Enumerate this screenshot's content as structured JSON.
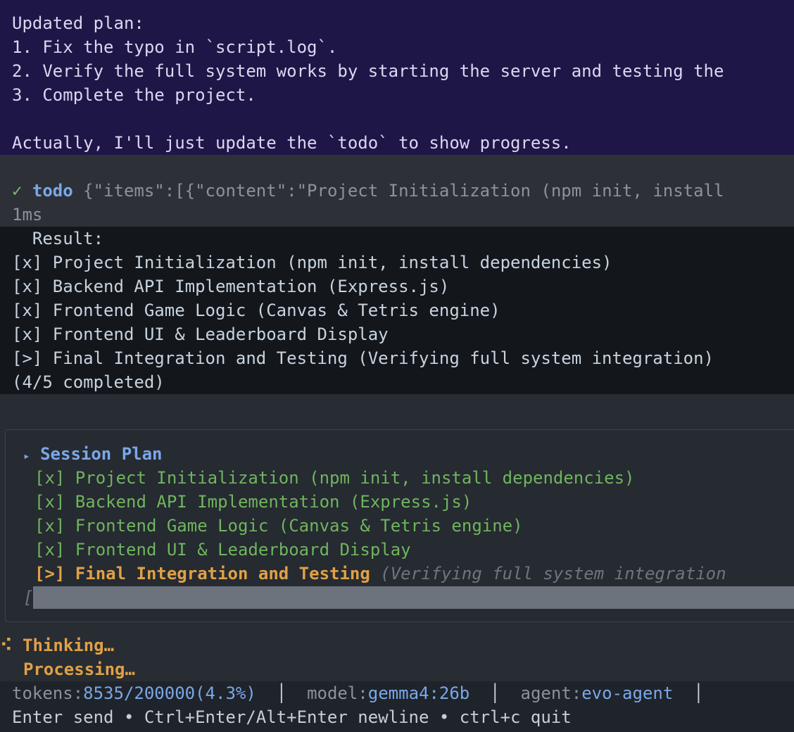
{
  "plan": {
    "lines": [
      "Updated plan:",
      "1. Fix the typo in `script.log`.",
      "2. Verify the full system works by starting the server and testing the",
      "3. Complete the project.",
      "",
      "Actually, I'll just update the `todo` to show progress."
    ]
  },
  "tool_call": {
    "status_icon": "✓",
    "name": "todo",
    "args": "{\"items\":[{\"content\":\"Project Initialization (npm init, install",
    "duration": "1ms"
  },
  "result": {
    "header": "  Result:",
    "items": [
      "[x] Project Initialization (npm init, install dependencies)",
      "[x] Backend API Implementation (Express.js)",
      "[x] Frontend Game Logic (Canvas & Tetris engine)",
      "[x] Frontend UI & Leaderboard Display",
      "[>] Final Integration and Testing (Verifying full system integration)"
    ],
    "summary": "(4/5 completed)"
  },
  "session_plan": {
    "toggle_icon": "▸",
    "title": "Session Plan",
    "done_items": [
      "[x] Project Initialization (npm init, install dependencies)",
      "[x] Backend API Implementation (Express.js)",
      "[x] Frontend Game Logic (Canvas & Tetris engine)",
      "[x] Frontend UI & Leaderboard Display"
    ],
    "current_item": "[>] Final Integration and Testing",
    "current_note": "(Verifying full system integration",
    "input_bracket": "["
  },
  "status": {
    "spinner": "⠪",
    "thinking": "Thinking…",
    "processing": "Processing…"
  },
  "status_bar": {
    "tokens_label": "tokens:",
    "tokens_value": "8535/200000(4.3%)",
    "model_label": "model:",
    "model_value": "gemma4:26b",
    "agent_label": "agent:",
    "agent_value": "evo-agent",
    "separator": "│",
    "hint": "Enter send • Ctrl+Enter/Alt+Enter newline • ctrl+c quit"
  },
  "colors": {
    "plan_bg": "#1f1648",
    "accent_blue": "#7aa8e8",
    "done_green": "#6fb55e",
    "current_orange": "#e0a145"
  }
}
